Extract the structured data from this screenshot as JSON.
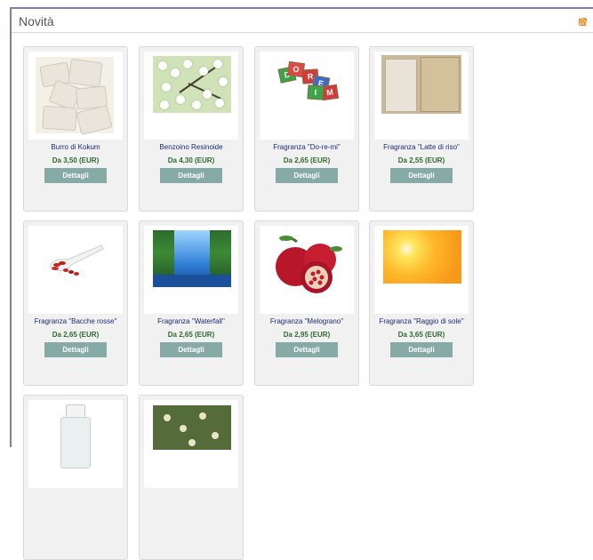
{
  "section": {
    "title": "Novità",
    "feed_icon": "rss-icon"
  },
  "colors": {
    "frame": "#8a7aa8",
    "card_bg": "#f1f1f1",
    "product_name": "#1d2a78",
    "price": "#2d6a2d",
    "button_bg": "#86aba6",
    "button_text": "#ffffff",
    "rss": "#f38a1f"
  },
  "products": [
    {
      "name": "Burro di Kokum",
      "price": "Da 3,50 (EUR)",
      "button": "Dettagli",
      "image": "kokum-butter-chunks"
    },
    {
      "name": "Benzoino Resinoide",
      "price": "Da 4,30 (EUR)",
      "button": "Dettagli",
      "image": "white-blossom-branch"
    },
    {
      "name": "Fragranza \"Do-re-mi\"",
      "price": "Da 2,65 (EUR)",
      "button": "Dettagli",
      "image": "letter-blocks-doremi"
    },
    {
      "name": "Fragranza \"Latte di riso\"",
      "price": "Da 2,55 (EUR)",
      "button": "Dettagli",
      "image": "rice-milk-glass"
    },
    {
      "name": "Fragranza \"Bacche rosse\"",
      "price": "Da 2,65 (EUR)",
      "button": "Dettagli",
      "image": "red-berries-spoon"
    },
    {
      "name": "Fragranza \"Waterfall\"",
      "price": "Da 2,65 (EUR)",
      "button": "Dettagli",
      "image": "waterfall-landscape"
    },
    {
      "name": "Fragranza \"Melograno\"",
      "price": "Da 2,95 (EUR)",
      "button": "Dettagli",
      "image": "pomegranate-fruit"
    },
    {
      "name": "Fragranza \"Raggio di sole\"",
      "price": "Da 3,65 (EUR)",
      "button": "Dettagli",
      "image": "sunburst"
    },
    {
      "image": "glass-bottle"
    },
    {
      "image": "white-flowers-branch"
    }
  ]
}
